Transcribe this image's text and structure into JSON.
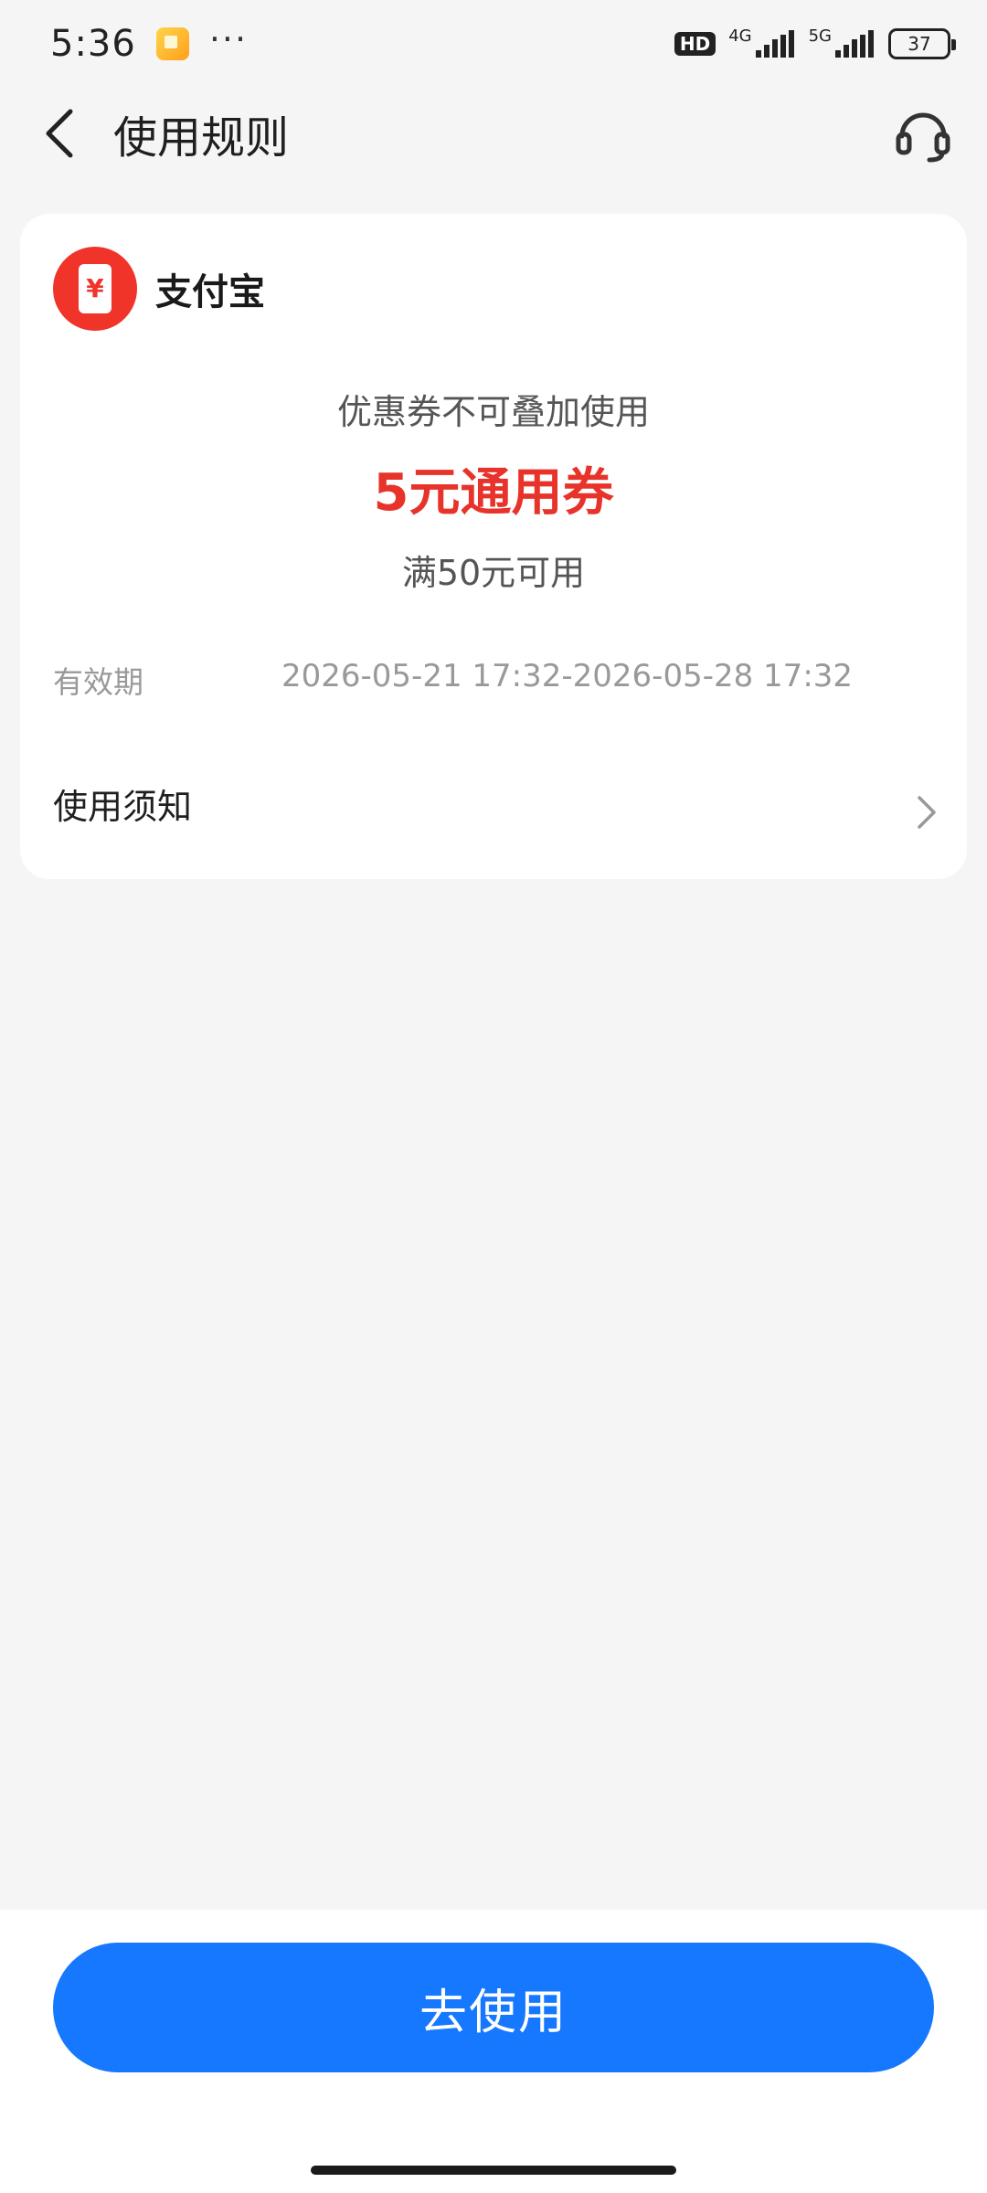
{
  "status_bar": {
    "time": "5:36",
    "hd_label": "HD",
    "network_1": "4G",
    "network_2": "5G",
    "battery": "37"
  },
  "nav": {
    "title": "使用规则",
    "back_icon": "chevron-left-icon",
    "support_icon": "headset-icon"
  },
  "card": {
    "merchant_name": "支付宝",
    "merchant_icon": "alipay-logo",
    "note": "优惠券不可叠加使用",
    "coupon_title": "5元通用券",
    "condition": "满50元可用",
    "validity_label": "有效期",
    "validity_value": "2026-05-21 17:32-2026-05-28 17:32",
    "notice_label": "使用须知"
  },
  "colors": {
    "accent": "#1677ff",
    "coupon_red": "#e8332a",
    "logo_red": "#f0342a",
    "background": "#f5f5f5"
  },
  "action": {
    "use_label": "去使用"
  }
}
